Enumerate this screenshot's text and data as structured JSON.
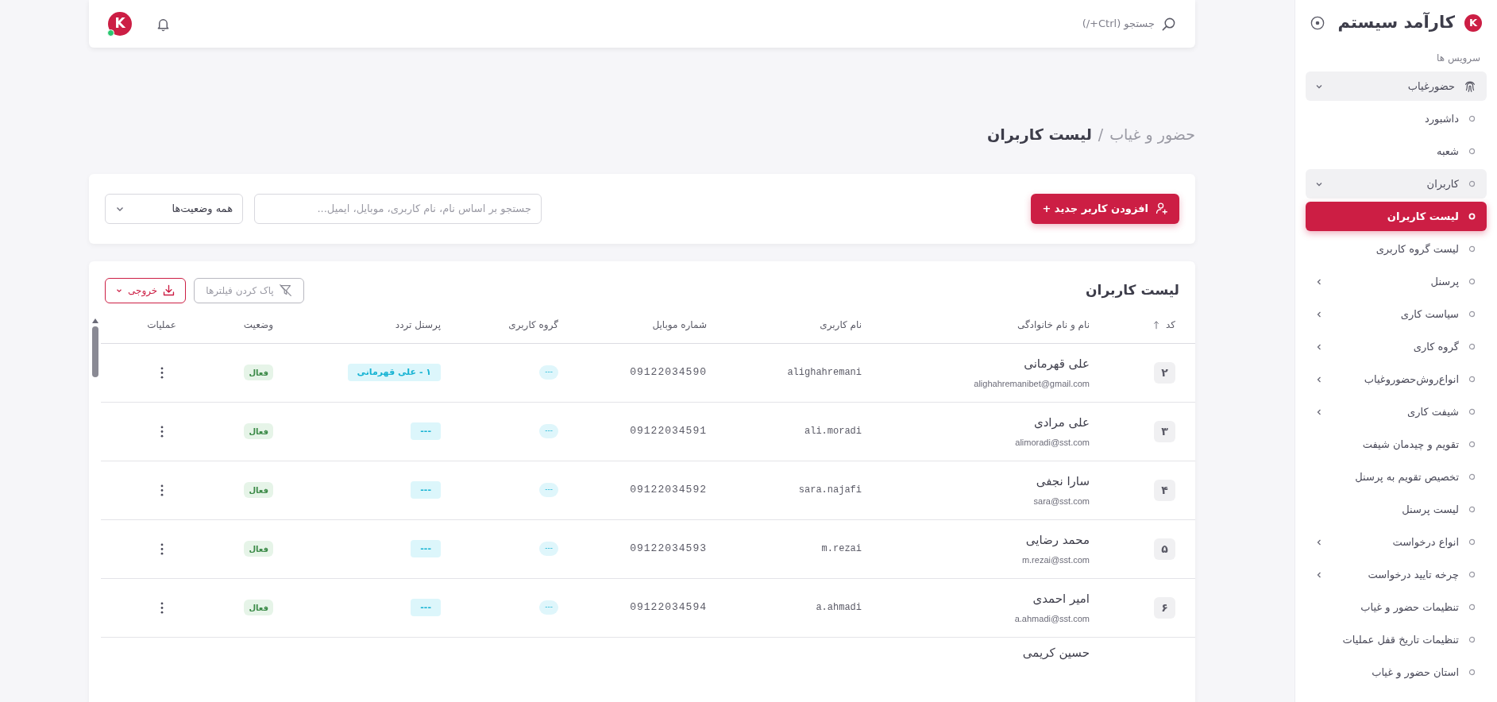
{
  "header": {
    "search": {
      "label": "جستجو (Ctrl+/)"
    },
    "avatar": {
      "mark": "K",
      "online": true
    }
  },
  "sidebar": {
    "brand": {
      "mark": "K",
      "title": "کارآمد سیستم"
    },
    "section_label": "سرویس ها",
    "items": [
      {
        "label": "حضورغیاب",
        "selected": false,
        "expanded": true,
        "children": [
          {
            "label": "داشبورد",
            "selected": false
          },
          {
            "label": "شعبه",
            "selected": false
          },
          {
            "label": "کاربران",
            "selected": false,
            "expanded": true,
            "children": [
              {
                "label": "لیست کاربران",
                "selected": true
              },
              {
                "label": "لیست گروه کاربری",
                "selected": false
              }
            ]
          },
          {
            "label": "پرسنل",
            "selected": false,
            "expanded": false
          },
          {
            "label": "سیاست کاری",
            "selected": false,
            "expanded": false
          },
          {
            "label": "گروه کاری",
            "selected": false,
            "expanded": false
          },
          {
            "label": "انواع‌روش‌حضوروغیاب",
            "selected": false,
            "expanded": false
          },
          {
            "label": "شیفت کاری",
            "selected": false,
            "expanded": false
          },
          {
            "label": "تقویم و چیدمان شیفت",
            "selected": false
          },
          {
            "label": "تخصیص تقویم به پرسنل",
            "selected": false
          },
          {
            "label": "لیست پرسنل",
            "selected": false
          },
          {
            "label": "انواع درخواست",
            "selected": false,
            "expanded": false
          },
          {
            "label": "چرخه تایید درخواست",
            "selected": false,
            "expanded": false
          },
          {
            "label": "تنظیمات حضور و غیاب",
            "selected": false
          },
          {
            "label": "تنظیمات تاریخ قفل عملیات",
            "selected": false
          },
          {
            "label": "استان حضور و غیاب",
            "selected": false
          }
        ]
      }
    ]
  },
  "breadcrumb": {
    "parent": "حضور و غیاب",
    "separator": "/",
    "current": "لیست کاربران"
  },
  "filter_bar": {
    "add_button": "افزودن کاربر جدید +",
    "search": {
      "placeholder": "جستجو بر اساس نام، نام کاربری، موبایل، ایمیل..."
    },
    "status_select": {
      "value": "همه وضعیت‌ها"
    }
  },
  "table": {
    "title": "لیست کاربران",
    "actions": [
      {
        "kind": "clear",
        "label": "پاک کردن فیلترها",
        "disabled": true
      },
      {
        "kind": "export",
        "label": "خروجی",
        "disabled": false
      }
    ],
    "columns": [
      {
        "label": "کد",
        "sorted_ascending": true
      },
      {
        "label": "نام و نام خانوادگی"
      },
      {
        "label": "نام کاربری"
      },
      {
        "label": "شماره موبایل"
      },
      {
        "label": "گروه کاربری"
      },
      {
        "label": "پرسنل تردد"
      },
      {
        "label": "وضعیت"
      },
      {
        "label": "عملیات"
      }
    ],
    "rows": [
      {
        "code": "۲",
        "name": "علی قهرمانی",
        "email": "alighahremanibet@gmail.com",
        "username": "alighahremani",
        "mobile": "09122034590",
        "group": "---",
        "personnel": "۱ - علی قهرمانی",
        "status": "فعال"
      },
      {
        "code": "۳",
        "name": "علی مرادی",
        "email": "alimoradi@sst.com",
        "username": "ali.moradi",
        "mobile": "09122034591",
        "group": "---",
        "personnel": "---",
        "status": "فعال"
      },
      {
        "code": "۴",
        "name": "سارا نجفی",
        "email": "sara@sst.com",
        "username": "sara.najafi",
        "mobile": "09122034592",
        "group": "---",
        "personnel": "---",
        "status": "فعال"
      },
      {
        "code": "۵",
        "name": "محمد رضایی",
        "email": "m.rezai@sst.com",
        "username": "m.rezai",
        "mobile": "09122034593",
        "group": "---",
        "personnel": "---",
        "status": "فعال"
      },
      {
        "code": "۶",
        "name": "امیر احمدی",
        "email": "a.ahmadi@sst.com",
        "username": "a.ahmadi",
        "mobile": "09122034594",
        "group": "---",
        "personnel": "---",
        "status": "فعال"
      },
      {
        "name": "حسین کریمی"
      }
    ]
  }
}
